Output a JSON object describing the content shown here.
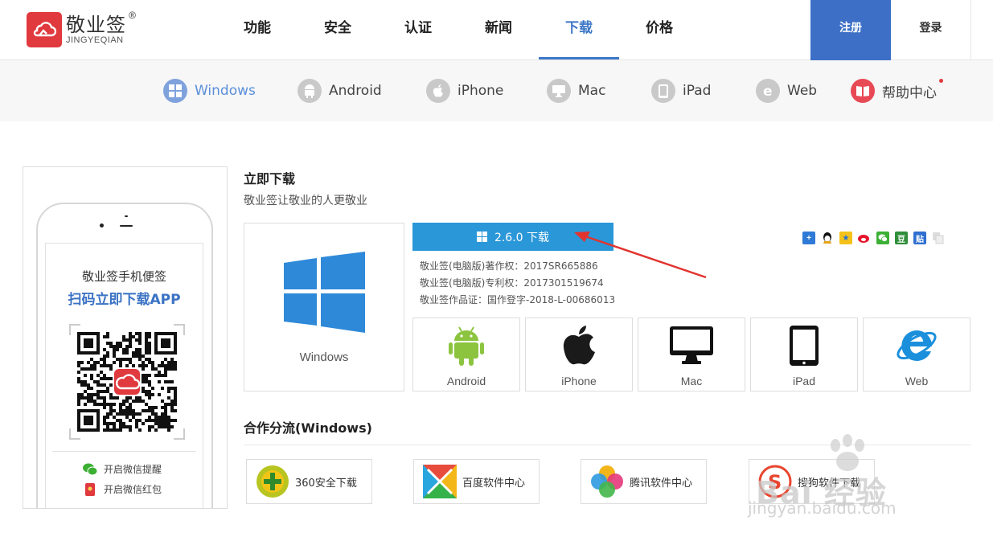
{
  "logo": {
    "name_cn": "敬业签",
    "name_en": "JINGYEQIAN",
    "reg": "®"
  },
  "nav": {
    "items": [
      {
        "label": "功能"
      },
      {
        "label": "安全"
      },
      {
        "label": "认证"
      },
      {
        "label": "新闻"
      },
      {
        "label": "下载",
        "active": true
      },
      {
        "label": "价格"
      }
    ],
    "register": "注册",
    "login": "登录"
  },
  "platforms": [
    {
      "label": "Windows",
      "icon": "windows-icon",
      "active": true
    },
    {
      "label": "Android",
      "icon": "android-icon"
    },
    {
      "label": "iPhone",
      "icon": "apple-icon"
    },
    {
      "label": "Mac",
      "icon": "monitor-icon"
    },
    {
      "label": "iPad",
      "icon": "tablet-icon"
    },
    {
      "label": "Web",
      "icon": "ie-icon"
    },
    {
      "label": "帮助中心",
      "icon": "book-icon"
    }
  ],
  "phone": {
    "title": "敬业签手机便签",
    "subtitle": "扫码立即下载APP",
    "links": [
      {
        "label": "开启微信提醒",
        "icon": "wechat-icon"
      },
      {
        "label": "开启微信红包",
        "icon": "red-envelope-icon"
      }
    ]
  },
  "main": {
    "title": "立即下载",
    "subtitle": "敬业签让敬业的人更敬业",
    "selected_os": "Windows",
    "download_label": "2.6.0 下载",
    "info": [
      "敬业签(电脑版)著作权：2017SR665886",
      "敬业签(电脑版)专利权：2017301519674",
      "敬业签作品证：国作登字-2018-L-00686013"
    ],
    "other_os": [
      {
        "label": "Android",
        "icon": "android-icon"
      },
      {
        "label": "iPhone",
        "icon": "apple-icon"
      },
      {
        "label": "Mac",
        "icon": "monitor-icon"
      },
      {
        "label": "iPad",
        "icon": "tablet-icon"
      },
      {
        "label": "Web",
        "icon": "ie-icon"
      }
    ]
  },
  "share": [
    "plus-icon",
    "qq-icon",
    "qzone-icon",
    "weibo-icon",
    "wechat-icon",
    "douban-icon",
    "tieba-icon",
    "copy-icon"
  ],
  "coop": {
    "title": "合作分流(Windows)",
    "items": [
      {
        "label": "360安全下载",
        "icon": "360-icon"
      },
      {
        "label": "百度软件中心",
        "icon": "baidu-soft-icon"
      },
      {
        "label": "腾讯软件中心",
        "icon": "tencent-soft-icon"
      },
      {
        "label": "搜狗软件下载",
        "icon": "sogou-icon"
      }
    ]
  },
  "watermark": {
    "text": "Bai 经验",
    "url": "jingyan.baidu.com"
  },
  "colors": {
    "brand_red": "#e0393e",
    "accent_blue": "#3d6fc6",
    "download_blue": "#2a97d8"
  }
}
